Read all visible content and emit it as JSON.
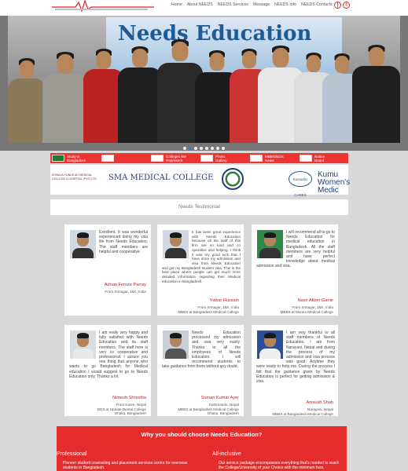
{
  "nav": {
    "items": [
      "Home",
      "About NEEDS",
      "NEEDS Services",
      "Message",
      "NEEDS Info",
      "NEEDS Contacts"
    ]
  },
  "social": [
    "f",
    "in"
  ],
  "hero": {
    "banner_text": "Needs Education",
    "slides": 8,
    "active_slide": 2
  },
  "ticker": [
    "Study in\nBangladesh",
    "",
    "Colleges We\nRepresent",
    "Photo\nGallery",
    "MBBS/BDS\nNews",
    "Notice\nBoard"
  ],
  "partners": [
    "KHWAJA YUNUS ALI MEDICAL COLLEGE & HOSPITAL (PVT) LTD.",
    "SMA MEDICAL COLLEGE",
    "",
    "Kumudini CARES",
    "Kumu\nWomen's Medic"
  ],
  "testimonial_heading": "Needs Testimonial",
  "testimonials": [
    {
      "text": "Excellent. It was wonderful experienced doing my visa file from Needs Education. The staff members are helpful and cooperative.",
      "name": "Adnan Feroze Parray",
      "location": "From Srinagar, J&K, India",
      "school": ""
    },
    {
      "text": "It has been great experience with Needs Education because all the staff of this firm are so kind and co operative and helping. I think it was my good luck that I have done my admission and visa from Needs Education and got my Bangladesh student visa. This is the best place where people can get much more detailed information regarding their Medical education in Bangladesh.",
      "name": "Yawar Hussain",
      "location": "From Srinagar, J&K, India",
      "school": "MBBS at Bangladesh Medical College"
    },
    {
      "text": "I will recommend all to go to Needs Education for medical education in Bangladesh. All the staff members are very helpful and have perfect knowledge about medical admission and visa.",
      "name": "Nasir Akber Ganie",
      "location": "From Srinagar, J&K, India",
      "school": "MBBS at Monno Medical College"
    },
    {
      "text": "I am really very happy and fully satisfied with Needs Education and its staff members. The staff here is very co cooperative and professional. I assure you one thing that anyone who wants to go Bangladesh for Medical education I would suggest to go to Needs Education only. Thanks a lot.",
      "name": "Nimesh Shrestha",
      "location": "From Kavre, Nepal",
      "school": "BDS at Update Dental College\nDhaka, Bangladesh"
    },
    {
      "text": "Needs Education processed my admission and visa very easily. Thanks to all the employees of Needs Education. I will recommend students to take guidance from them without any doubt.",
      "name": "Suman Kumar Ayer",
      "location": "Kathmandu, Nepal",
      "school": "MBBS at Bangladesh Medical College\nDhaka, Bangladesh"
    },
    {
      "text": "I am very thankful to all staff members of Needs Education. I am from Narayani, Nepal and during the process of my admission and visa process was good. Anytime they were ready to help me. During the process I felt that the guidance given by Needs Education is perfect for getting admission & visa.",
      "name": "Anisush Shah",
      "location": "Narayani, Nepal",
      "school": "MBBS at Bangladesh Medical College"
    }
  ],
  "why": {
    "title": "Why you should choose Needs Education?",
    "columns": [
      {
        "title": "Professional",
        "text": "Pioneer student counseling and placement services centre for overseas students in Bangladesh."
      },
      {
        "title": "All-inclusive",
        "text": "Our service package encompasses everything that's needed to reach the College/University of your Choice with the minimum fuss."
      }
    ]
  },
  "colors": {
    "accent_red": "#e52c2c",
    "name_red": "#d11",
    "active_dot": "#3a7bc8"
  }
}
